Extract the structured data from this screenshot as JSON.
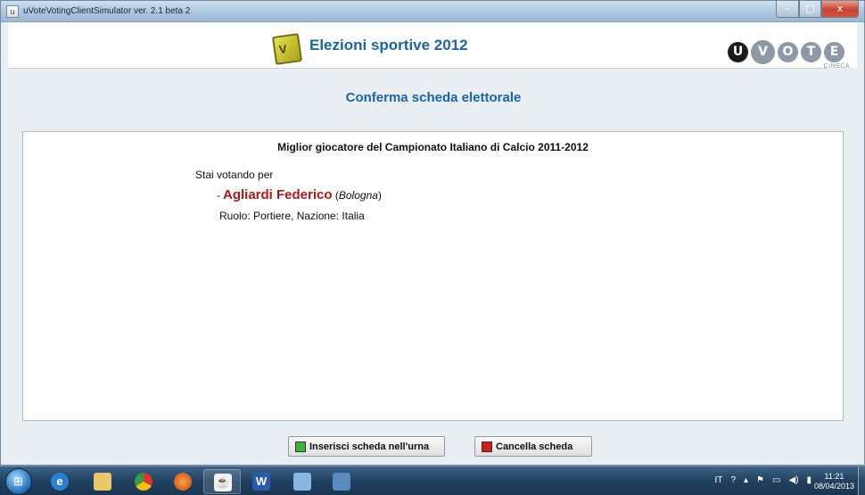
{
  "window": {
    "title": "uVoteVotingClientSimulator ver. 2.1 beta 2",
    "min_glyph": "–",
    "max_glyph": "□",
    "close_glyph": "x"
  },
  "header": {
    "app_title": "Elezioni sportive 2012",
    "logo_letter": "V",
    "brand_letters": [
      "U",
      "V",
      "O",
      "T",
      "E"
    ],
    "brand_sub": "CINECA"
  },
  "page": {
    "title": "Conferma scheda elettorale"
  },
  "ballot": {
    "question": "Miglior giocatore del Campionato Italiano di Calcio 2011-2012",
    "voting_label": "Stai votando per",
    "candidate": {
      "dash": "-",
      "name": "Agliardi Federico",
      "team_open": "(",
      "team": "Bologna",
      "team_close": ")"
    },
    "role_line": "Ruolo: Portiere, Nazione: Italia"
  },
  "buttons": {
    "insert_label": "Inserisci scheda nell'urna",
    "cancel_label": "Cancella scheda"
  },
  "taskbar": {
    "apps": [
      "internet-explorer",
      "file-explorer",
      "chrome",
      "firefox",
      "java",
      "word",
      "paint",
      "monitor"
    ],
    "tray_language": "IT",
    "clock_time": "11:21",
    "clock_date": "08/04/2013"
  },
  "colors": {
    "accent_blue": "#1a64a7",
    "candidate_red": "#b51616",
    "insert_green": "#3cb33a",
    "cancel_red": "#d11b1b"
  }
}
